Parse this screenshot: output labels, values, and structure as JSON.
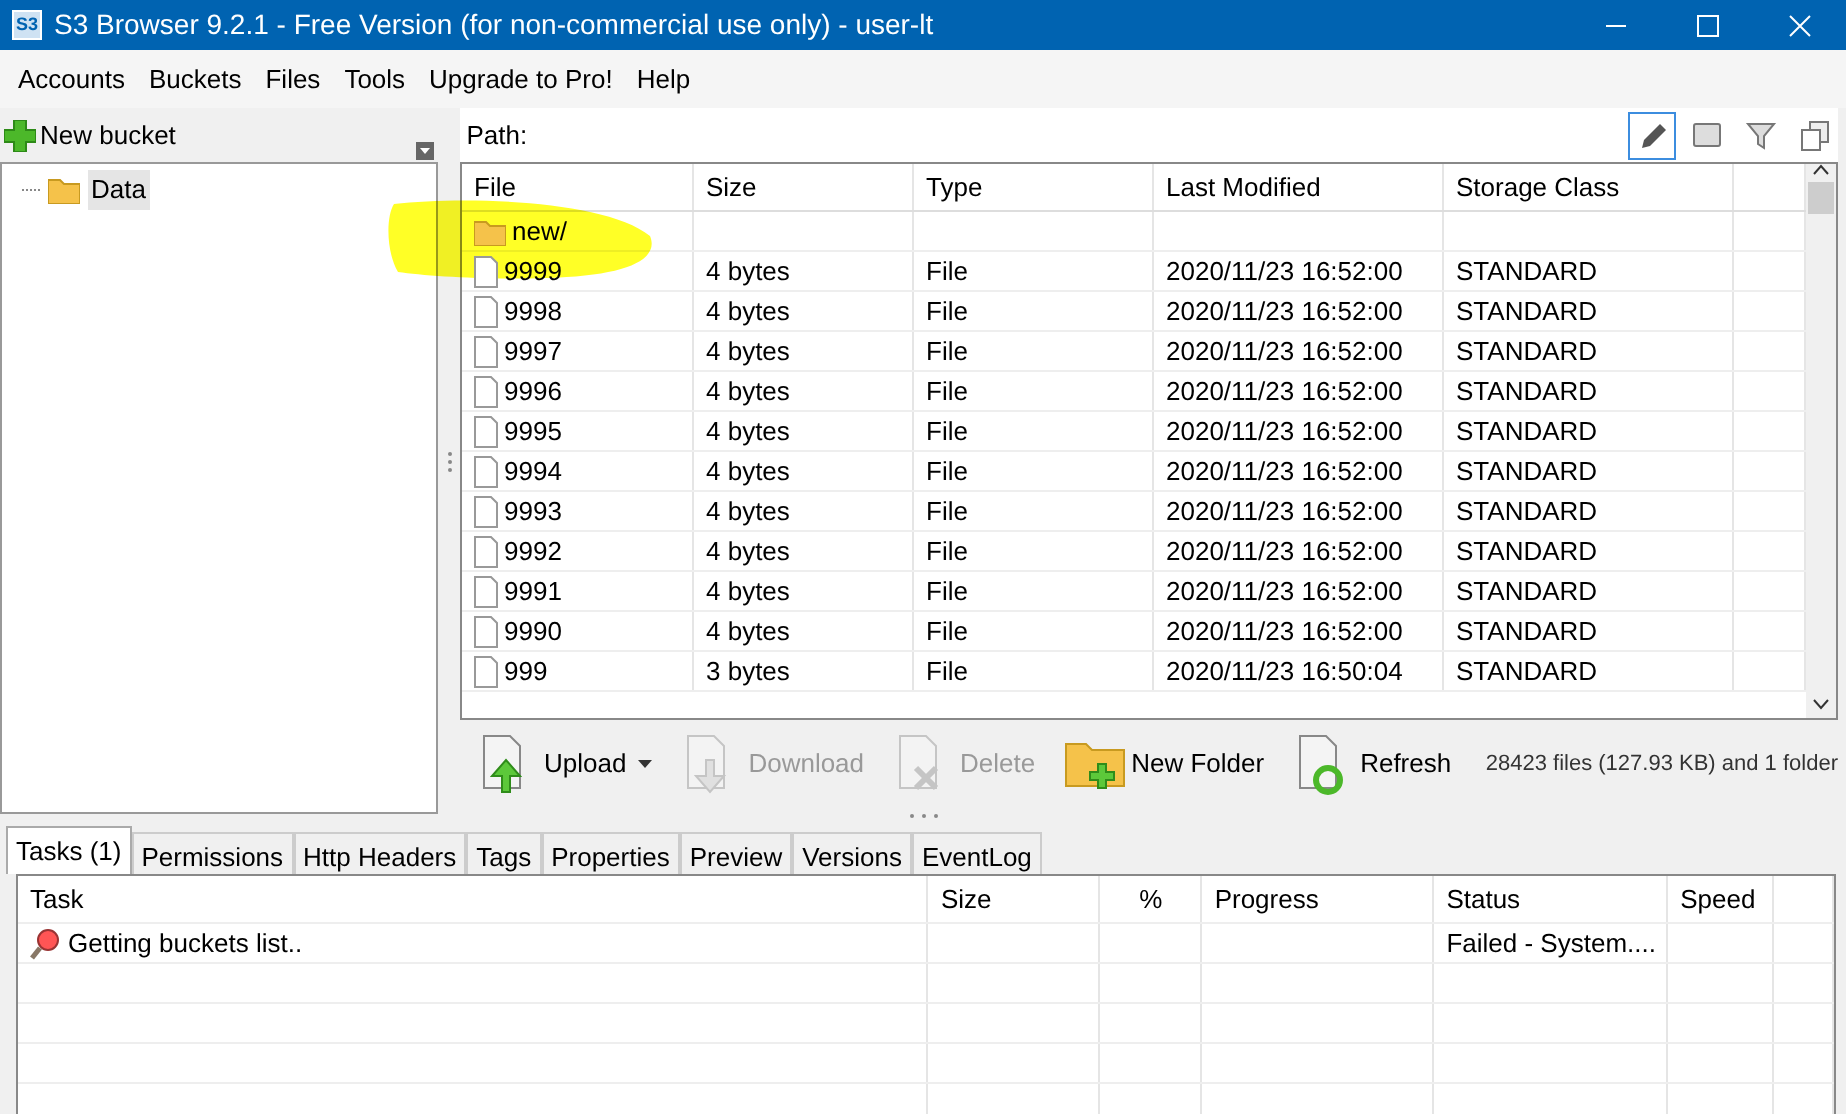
{
  "window": {
    "title": "S3 Browser 9.2.1 - Free Version (for non-commercial use only) - user-lt",
    "app_icon": "S3"
  },
  "menu": [
    "Accounts",
    "Buckets",
    "Files",
    "Tools",
    "Upgrade to Pro!",
    "Help"
  ],
  "left_toolbar": {
    "new_bucket": "New bucket"
  },
  "tree": [
    {
      "label": "Data",
      "selected": true
    }
  ],
  "path": {
    "label": "Path:"
  },
  "view_tools": [
    {
      "kind": "edit",
      "selected": true
    },
    {
      "kind": "panel",
      "selected": false
    },
    {
      "kind": "filter",
      "selected": false
    },
    {
      "kind": "copy",
      "selected": false
    }
  ],
  "files": {
    "columns": [
      "File",
      "Size",
      "Type",
      "Last Modified",
      "Storage Class"
    ],
    "rows": [
      {
        "kind": "folder",
        "name": "new/",
        "size": "",
        "type": "",
        "modified": "",
        "storage": ""
      },
      {
        "kind": "file",
        "name": "9999",
        "size": "4 bytes",
        "type": "File",
        "modified": "2020/11/23 16:52:00",
        "storage": "STANDARD"
      },
      {
        "kind": "file",
        "name": "9998",
        "size": "4 bytes",
        "type": "File",
        "modified": "2020/11/23 16:52:00",
        "storage": "STANDARD"
      },
      {
        "kind": "file",
        "name": "9997",
        "size": "4 bytes",
        "type": "File",
        "modified": "2020/11/23 16:52:00",
        "storage": "STANDARD"
      },
      {
        "kind": "file",
        "name": "9996",
        "size": "4 bytes",
        "type": "File",
        "modified": "2020/11/23 16:52:00",
        "storage": "STANDARD"
      },
      {
        "kind": "file",
        "name": "9995",
        "size": "4 bytes",
        "type": "File",
        "modified": "2020/11/23 16:52:00",
        "storage": "STANDARD"
      },
      {
        "kind": "file",
        "name": "9994",
        "size": "4 bytes",
        "type": "File",
        "modified": "2020/11/23 16:52:00",
        "storage": "STANDARD"
      },
      {
        "kind": "file",
        "name": "9993",
        "size": "4 bytes",
        "type": "File",
        "modified": "2020/11/23 16:52:00",
        "storage": "STANDARD"
      },
      {
        "kind": "file",
        "name": "9992",
        "size": "4 bytes",
        "type": "File",
        "modified": "2020/11/23 16:52:00",
        "storage": "STANDARD"
      },
      {
        "kind": "file",
        "name": "9991",
        "size": "4 bytes",
        "type": "File",
        "modified": "2020/11/23 16:52:00",
        "storage": "STANDARD"
      },
      {
        "kind": "file",
        "name": "9990",
        "size": "4 bytes",
        "type": "File",
        "modified": "2020/11/23 16:52:00",
        "storage": "STANDARD"
      },
      {
        "kind": "file",
        "name": "999",
        "size": "3 bytes",
        "type": "File",
        "modified": "2020/11/23 16:50:04",
        "storage": "STANDARD"
      }
    ]
  },
  "actions": [
    {
      "kind": "upload",
      "label": "Upload",
      "disabled": false,
      "dropdown": true
    },
    {
      "kind": "download",
      "label": "Download",
      "disabled": true,
      "dropdown": false
    },
    {
      "kind": "delete",
      "label": "Delete",
      "disabled": true,
      "dropdown": false
    },
    {
      "kind": "new-folder",
      "label": "New Folder",
      "disabled": false,
      "dropdown": false
    },
    {
      "kind": "refresh",
      "label": "Refresh",
      "disabled": false,
      "dropdown": false
    }
  ],
  "summary": "28423 files (127.93 KB) and 1 folder",
  "tabs": [
    {
      "label": "Tasks (1)",
      "selected": true
    },
    {
      "label": "Permissions",
      "selected": false
    },
    {
      "label": "Http Headers",
      "selected": false
    },
    {
      "label": "Tags",
      "selected": false
    },
    {
      "label": "Properties",
      "selected": false
    },
    {
      "label": "Preview",
      "selected": false
    },
    {
      "label": "Versions",
      "selected": false
    },
    {
      "label": "EventLog",
      "selected": false
    }
  ],
  "tasks": {
    "columns": [
      "Task",
      "Size",
      "%",
      "Progress",
      "Status",
      "Speed"
    ],
    "rows": [
      {
        "task": "Getting buckets list..",
        "size": "",
        "percent": "",
        "progress": "",
        "status": "Failed - System...."
      }
    ]
  },
  "highlight": {
    "kind": "marker"
  }
}
